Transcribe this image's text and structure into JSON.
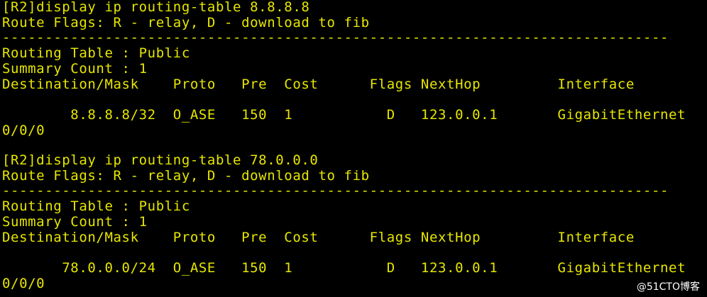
{
  "terminal": {
    "fg_color": "#e6e600",
    "bg_color": "#000000",
    "lines": [
      "[R2]display ip routing-table 8.8.8.8",
      "Route Flags: R - relay, D - download to fib",
      "------------------------------------------------------------------------------",
      "Routing Table : Public",
      "Summary Count : 1",
      "Destination/Mask    Proto   Pre  Cost      Flags NextHop         Interface",
      "",
      "        8.8.8.8/32  O_ASE   150  1           D   123.0.0.1       GigabitEthernet",
      "0/0/0",
      "[R2]display ip routing-table 78.0.0.0",
      "Route Flags: R - relay, D - download to fib",
      "------------------------------------------------------------------------------",
      "Routing Table : Public",
      "Summary Count : 1",
      "Destination/Mask    Proto   Pre  Cost      Flags NextHop         Interface",
      "",
      "       78.0.0.0/24  O_ASE   150  1           D   123.0.0.1       GigabitEthernet",
      "0/0/0"
    ]
  },
  "watermark": {
    "text": "@51CTO博客"
  }
}
